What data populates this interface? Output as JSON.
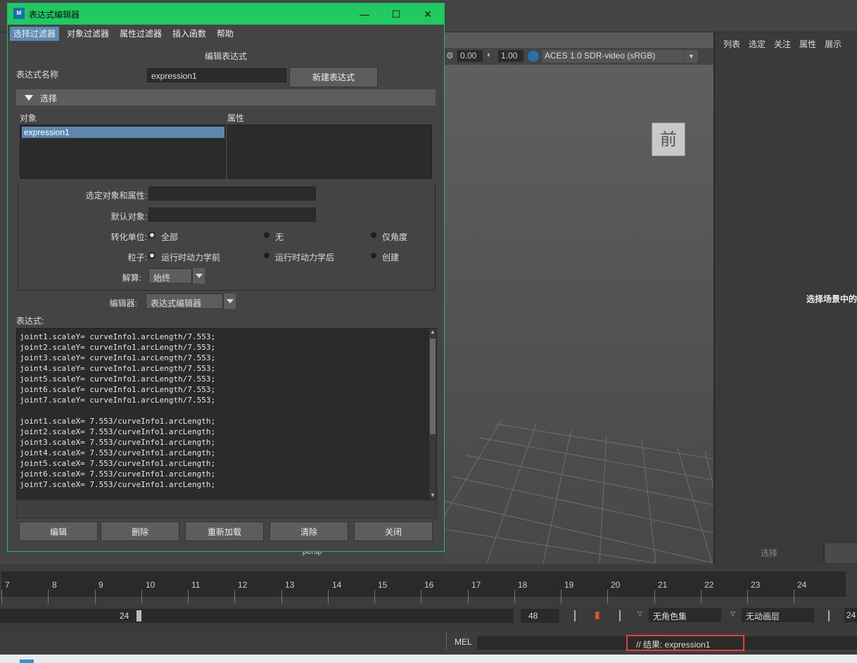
{
  "dialog": {
    "title": "表达式编辑器",
    "app_icon_text": "M",
    "window_controls": {
      "minimize": "—",
      "maximize": "☐",
      "close": "✕"
    },
    "menu": [
      "选择过滤器",
      "对象过滤器",
      "属性过滤器",
      "插入函数",
      "帮助"
    ],
    "heading": "编辑表达式",
    "name_label": "表达式名称",
    "name_value": "expression1",
    "new_expression_button": "新建表达式",
    "select_section": "选择",
    "objects_label": "对象",
    "attributes_label": "属性",
    "objects": [
      "expression1"
    ],
    "selected_obj_attr_label": "选定对象和属性:",
    "default_object_label": "默认对象:",
    "convert_units": {
      "label": "转化单位:",
      "options": [
        "全部",
        "无",
        "仅角度"
      ],
      "selected": "全部"
    },
    "particle": {
      "label": "粒子:",
      "options": [
        "运行时动力学前",
        "运行时动力学后",
        "创建"
      ],
      "selected": "运行时动力学前"
    },
    "evaluation": {
      "label": "解算:",
      "value": "始终"
    },
    "editor": {
      "label": "编辑器:",
      "value": "表达式编辑器"
    },
    "expression_label": "表达式:",
    "expression_code": "joint1.scaleY= curveInfo1.arcLength/7.553;\njoint2.scaleY= curveInfo1.arcLength/7.553;\njoint3.scaleY= curveInfo1.arcLength/7.553;\njoint4.scaleY= curveInfo1.arcLength/7.553;\njoint5.scaleY= curveInfo1.arcLength/7.553;\njoint6.scaleY= curveInfo1.arcLength/7.553;\njoint7.scaleY= curveInfo1.arcLength/7.553;\n\njoint1.scaleX= 7.553/curveInfo1.arcLength;\njoint2.scaleX= 7.553/curveInfo1.arcLength;\njoint3.scaleX= 7.553/curveInfo1.arcLength;\njoint4.scaleX= 7.553/curveInfo1.arcLength;\njoint5.scaleX= 7.553/curveInfo1.arcLength;\njoint6.scaleX= 7.553/curveInfo1.arcLength;\njoint7.scaleX= 7.553/curveInfo1.arcLength;",
    "buttons": [
      "编辑",
      "删除",
      "重新加载",
      "清除",
      "关闭"
    ]
  },
  "viewport": {
    "exposure": "0.00",
    "gamma": "1.00",
    "color_space": "ACES 1.0 SDR-video (sRGB)",
    "viewcube_label": "前",
    "camera_label": "persp"
  },
  "right_panel": {
    "menu": [
      "列表",
      "选定",
      "关注",
      "属性",
      "展示"
    ],
    "hint": "选择场景中的",
    "tab_select": "选择"
  },
  "timeline": {
    "frames": [
      "7",
      "8",
      "9",
      "10",
      "11",
      "12",
      "13",
      "14",
      "15",
      "16",
      "17",
      "18",
      "19",
      "20",
      "21",
      "22",
      "23",
      "24"
    ]
  },
  "range": {
    "current": "24",
    "end": "48",
    "character_set": "无角色集",
    "anim_layer": "无动画层",
    "end2": "24"
  },
  "command": {
    "mel_label": "MEL",
    "result": "// 结果: expression1"
  },
  "colors": {
    "titlebar": "#22c861",
    "selection": "#5e87b0",
    "result_highlight": "#e04040"
  }
}
